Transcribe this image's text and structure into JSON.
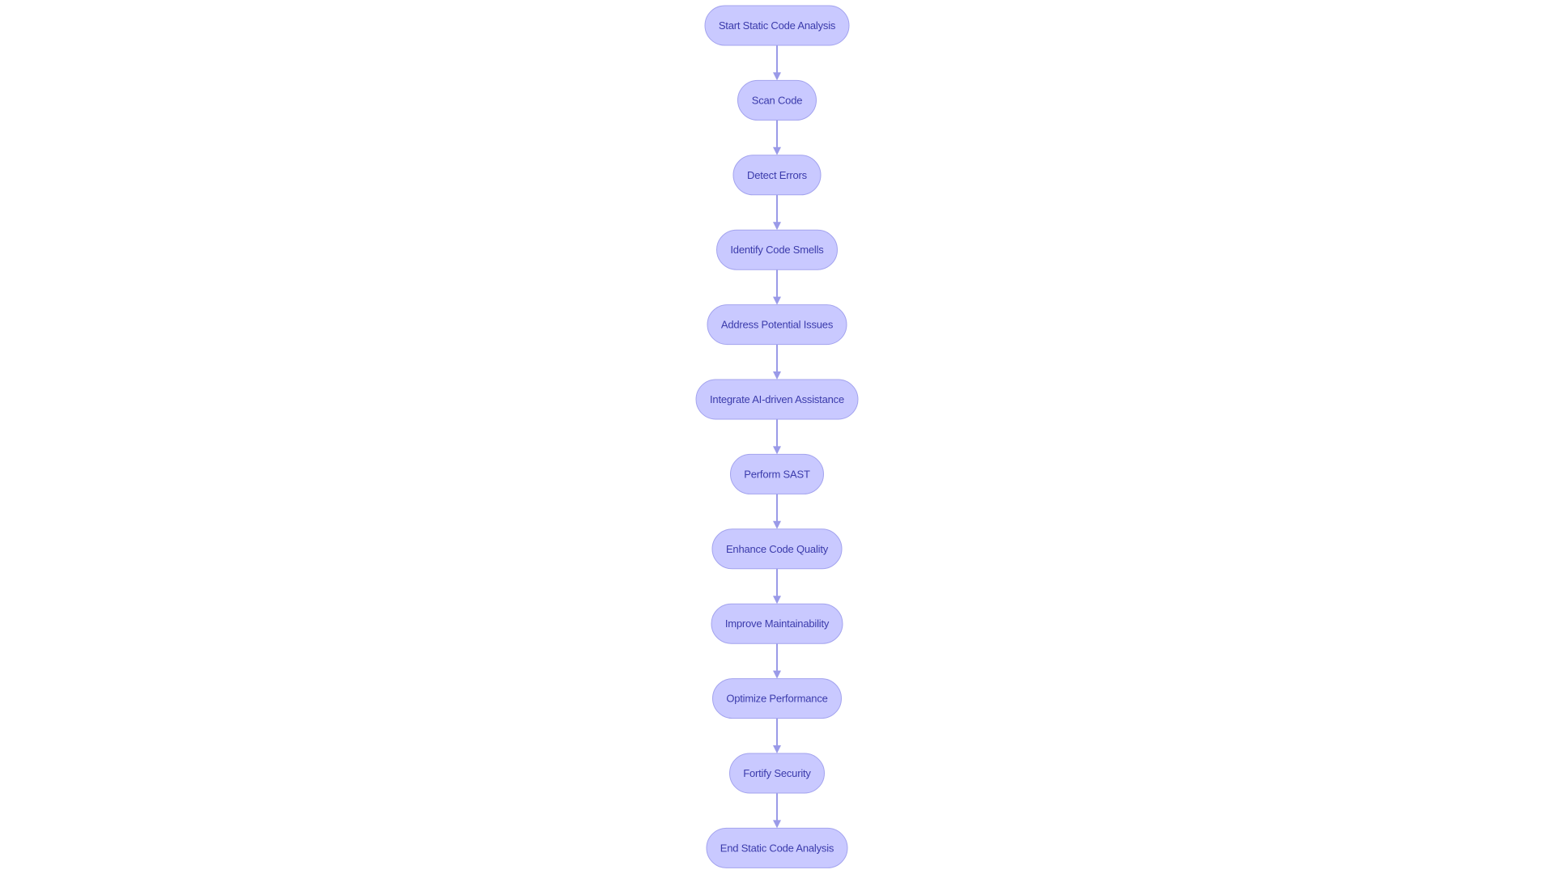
{
  "diagram": {
    "type": "flowchart",
    "direction": "top-to-bottom",
    "colors": {
      "node_fill": "#c9c9ff",
      "node_stroke": "#a3a3ee",
      "node_text": "#3b3bab",
      "edge": "#9a9ae8",
      "background": "#ffffff"
    },
    "nodes": [
      {
        "id": "start",
        "label": "Start Static Code Analysis",
        "shape": "stadium"
      },
      {
        "id": "scan",
        "label": "Scan Code",
        "shape": "stadium"
      },
      {
        "id": "detect",
        "label": "Detect Errors",
        "shape": "stadium"
      },
      {
        "id": "smells",
        "label": "Identify Code Smells",
        "shape": "stadium"
      },
      {
        "id": "address",
        "label": "Address Potential Issues",
        "shape": "stadium"
      },
      {
        "id": "ai",
        "label": "Integrate AI-driven Assistance",
        "shape": "stadium"
      },
      {
        "id": "sast",
        "label": "Perform SAST",
        "shape": "stadium"
      },
      {
        "id": "quality",
        "label": "Enhance Code Quality",
        "shape": "stadium"
      },
      {
        "id": "maintain",
        "label": "Improve Maintainability",
        "shape": "stadium"
      },
      {
        "id": "perf",
        "label": "Optimize Performance",
        "shape": "stadium"
      },
      {
        "id": "security",
        "label": "Fortify Security",
        "shape": "stadium"
      },
      {
        "id": "end",
        "label": "End Static Code Analysis",
        "shape": "stadium"
      }
    ],
    "edges": [
      {
        "from": "start",
        "to": "scan"
      },
      {
        "from": "scan",
        "to": "detect"
      },
      {
        "from": "detect",
        "to": "smells"
      },
      {
        "from": "smells",
        "to": "address"
      },
      {
        "from": "address",
        "to": "ai"
      },
      {
        "from": "ai",
        "to": "sast"
      },
      {
        "from": "sast",
        "to": "quality"
      },
      {
        "from": "quality",
        "to": "maintain"
      },
      {
        "from": "maintain",
        "to": "perf"
      },
      {
        "from": "perf",
        "to": "security"
      },
      {
        "from": "security",
        "to": "end"
      }
    ]
  }
}
